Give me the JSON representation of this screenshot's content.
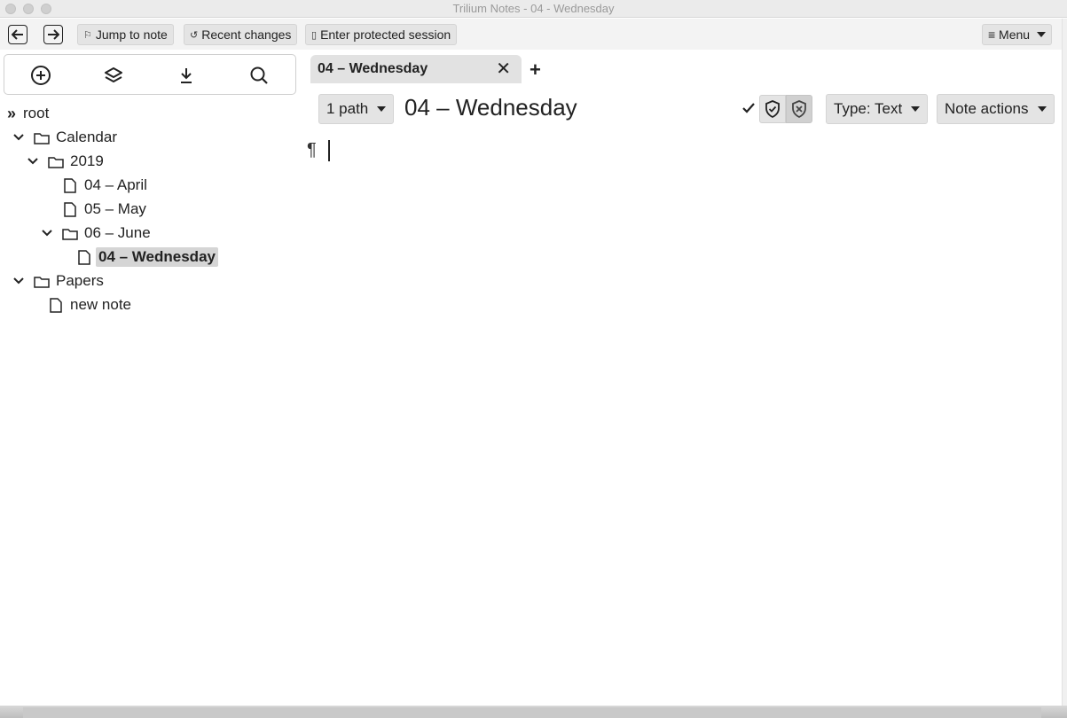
{
  "window": {
    "title": "Trilium Notes - 04 - Wednesday"
  },
  "toolbar": {
    "back_icon": "arrow-left-icon",
    "forward_icon": "arrow-right-icon",
    "jump_label": "Jump to note",
    "recent_label": "Recent changes",
    "protected_label": "Enter protected session",
    "menu_label": "≡ Menu"
  },
  "actions": {
    "icons": [
      "create-note-icon",
      "collapse-tree-icon",
      "download-icon",
      "search-icon"
    ]
  },
  "tree": {
    "root": "root",
    "calendar": "Calendar",
    "year": "2019",
    "april": "04 – April",
    "may": "05 – May",
    "june": "06 – June",
    "wednesday": "04 – Wednesday",
    "papers": "Papers",
    "new_note": "new note"
  },
  "tabs": {
    "active": "04 – Wednesday",
    "add": "+"
  },
  "note": {
    "path_label": "1 path",
    "title": "04 – Wednesday",
    "type_label": "Type: Text",
    "actions_label": "Note actions",
    "pilcrow": "¶"
  },
  "colors": {
    "selected_bg": "#d5d5d5",
    "button_bg": "#e4e4e4",
    "toolbar_bg": "#f3f3f3"
  }
}
